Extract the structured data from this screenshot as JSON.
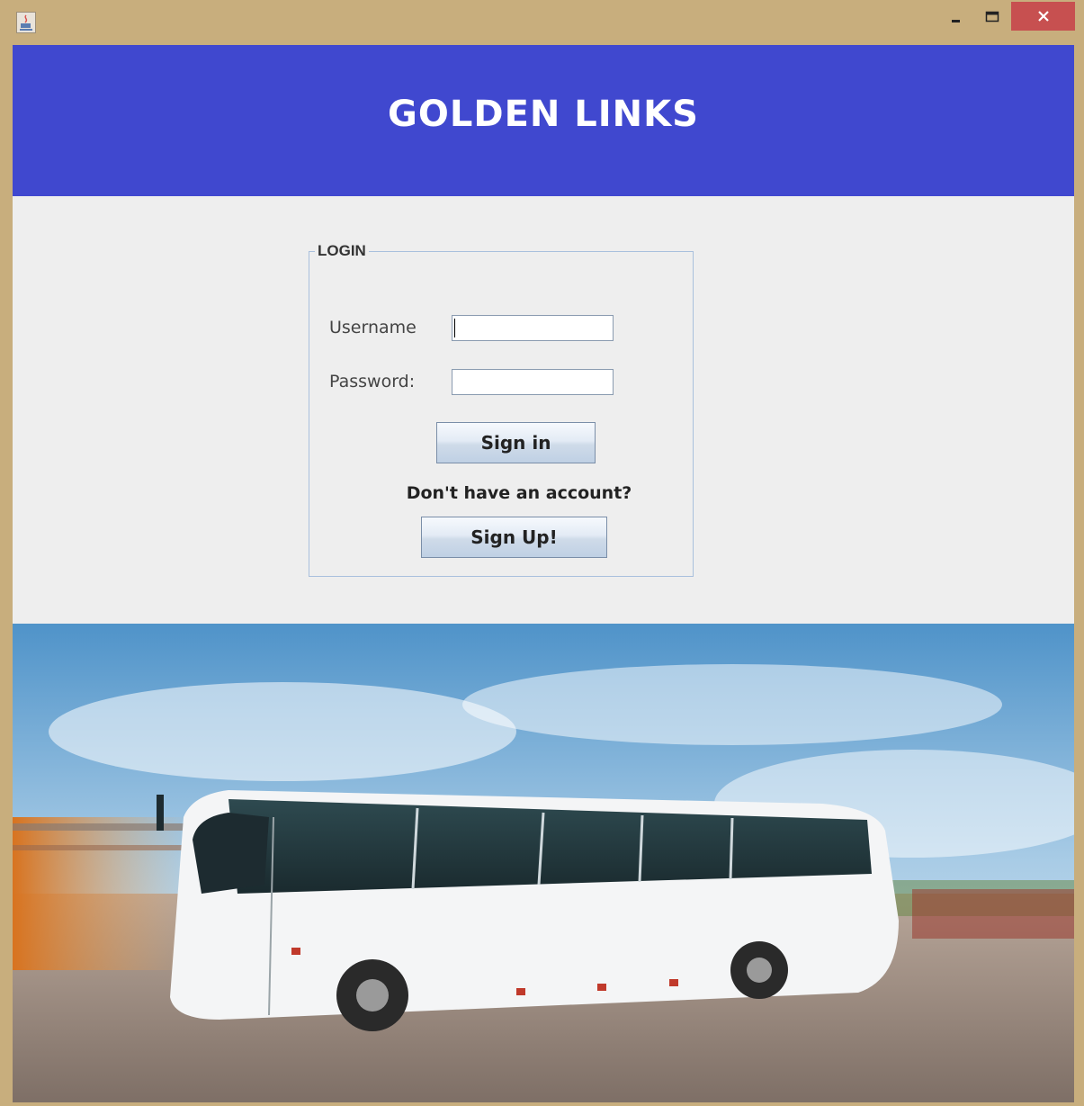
{
  "window": {
    "controls": {
      "minimize_icon": "minimize-icon",
      "maximize_icon": "maximize-icon",
      "close_icon": "close-icon"
    }
  },
  "header": {
    "title": "GOLDEN LINKS",
    "background": "#4048cf"
  },
  "login": {
    "legend": "LOGIN",
    "username_label": "Username",
    "username_value": "",
    "password_label": "Password:",
    "password_value": "",
    "signin_label": "Sign in",
    "no_account_text": "Don't have an account?",
    "signup_label": "Sign Up!"
  },
  "colors": {
    "frame": "#c8ae7d",
    "close_button": "#c75050",
    "panel": "#eeeeee",
    "legend_border": "#a9c0dd"
  }
}
